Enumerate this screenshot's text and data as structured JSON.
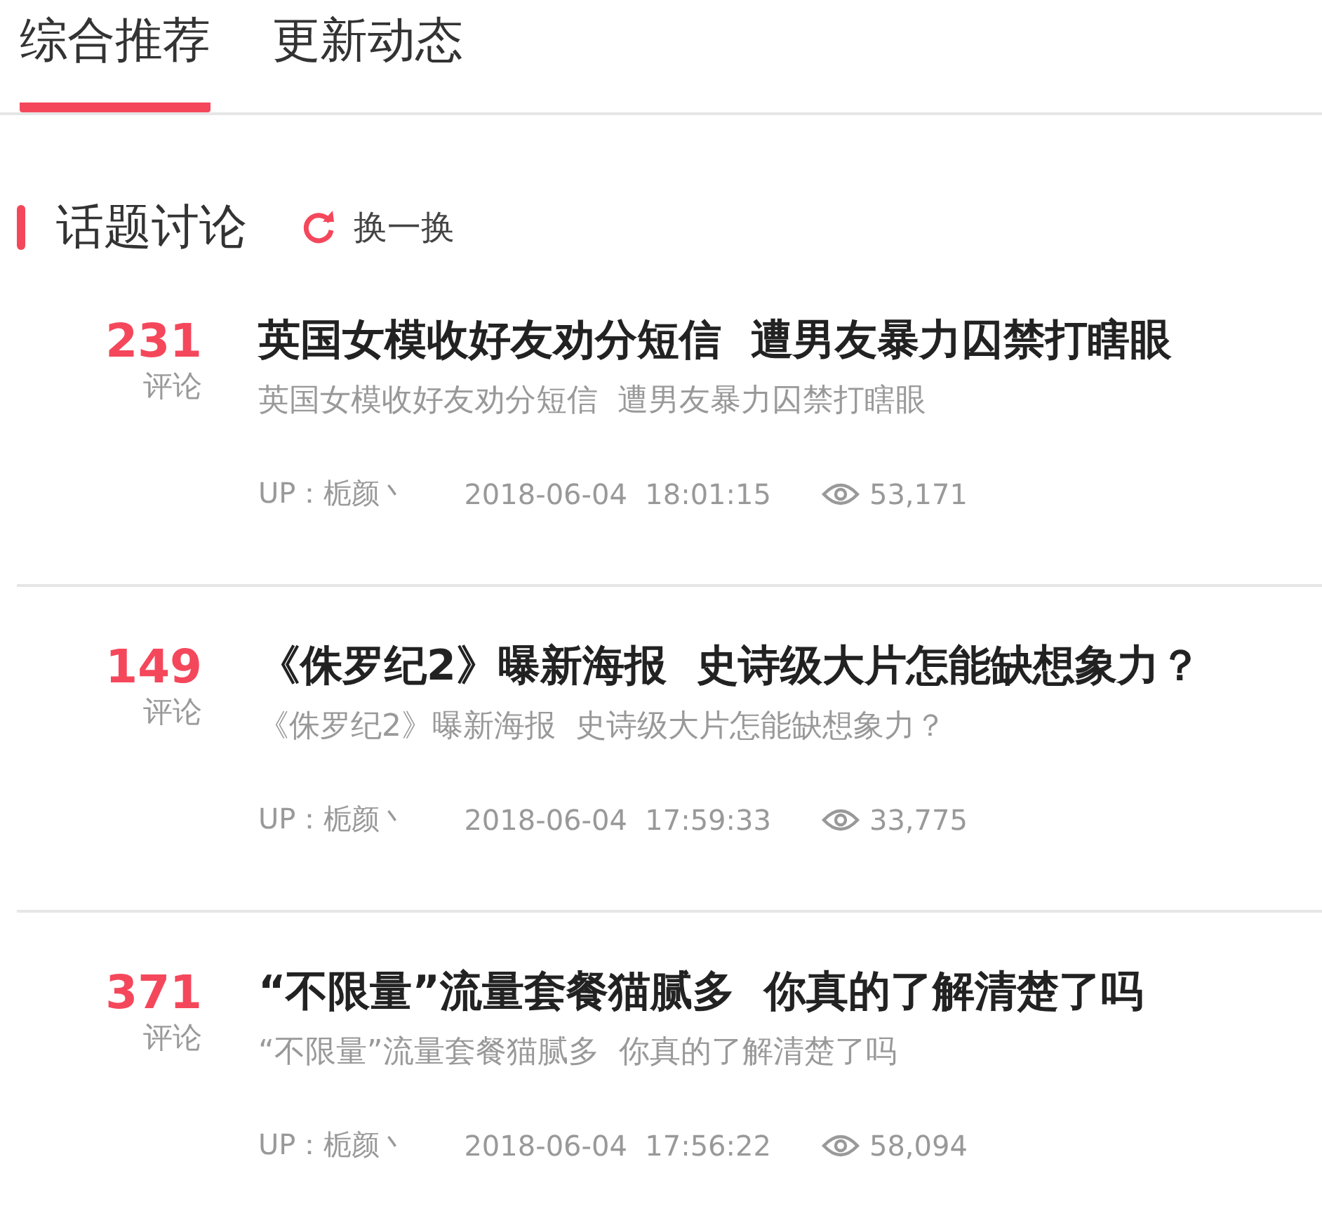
{
  "tabs": [
    {
      "label": "综合推荐",
      "selected": true
    },
    {
      "label": "更新动态",
      "selected": false
    }
  ],
  "section": {
    "title": "话题讨论",
    "refresh": "换一换"
  },
  "topics": [
    {
      "count": "231",
      "count_label": "评论",
      "title": "英国女模收好友劝分短信  遭男友暴力囚禁打瞎眼",
      "summary": "英国女模收好友劝分短信  遭男友暴力囚禁打瞎眼",
      "author": "UP：栀颜丶",
      "time": "2018-06-04  18:01:15",
      "views": "53,171"
    },
    {
      "count": "149",
      "count_label": "评论",
      "title": "《侏罗纪2》曝新海报  史诗级大片怎能缺想象力？",
      "summary": "《侏罗纪2》曝新海报  史诗级大片怎能缺想象力？",
      "author": "UP：栀颜丶",
      "time": "2018-06-04  17:59:33",
      "views": "33,775"
    },
    {
      "count": "371",
      "count_label": "评论",
      "title": "“不限量”流量套餐猫腻多  你真的了解清楚了吗",
      "summary": "“不限量”流量套餐猫腻多  你真的了解清楚了吗",
      "author": "UP：栀颜丶",
      "time": "2018-06-04  17:56:22",
      "views": "58,094"
    }
  ]
}
